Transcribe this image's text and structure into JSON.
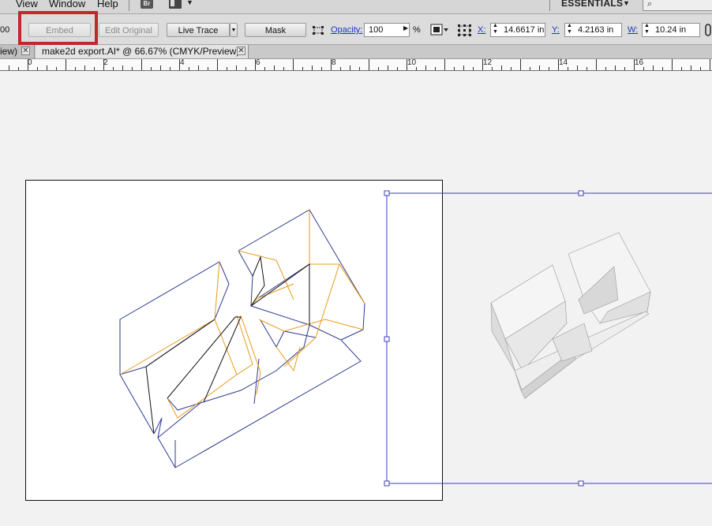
{
  "menubar": {
    "items": [
      "View",
      "Window",
      "Help"
    ],
    "bridge_label": "Br",
    "workspace": "ESSENTIALS"
  },
  "controlbar": {
    "left_value": "00",
    "embed_label": "Embed",
    "edit_original_label": "Edit Original",
    "live_trace_label": "Live Trace",
    "mask_label": "Mask",
    "opacity_label": "Opacity:",
    "opacity_value": "100",
    "opacity_unit": "%",
    "x_label": "X:",
    "x_value": "14.6617 in",
    "y_label": "Y:",
    "y_value": "4.2163 in",
    "w_label": "W:",
    "w_value": "10.24 in"
  },
  "tabs": [
    {
      "label": "iew)"
    },
    {
      "label": "make2d export.AI* @ 66.67% (CMYK/Preview)"
    }
  ],
  "ruler": {
    "labels": [
      "0",
      "2",
      "4",
      "6",
      "8",
      "10",
      "12",
      "14",
      "16"
    ]
  },
  "colors": {
    "highlight": "#c1272d",
    "link": "#1a37c4",
    "selection": "#3a3fbf",
    "line_blue": "#2b3a8f",
    "line_orange": "#e89a1a"
  }
}
